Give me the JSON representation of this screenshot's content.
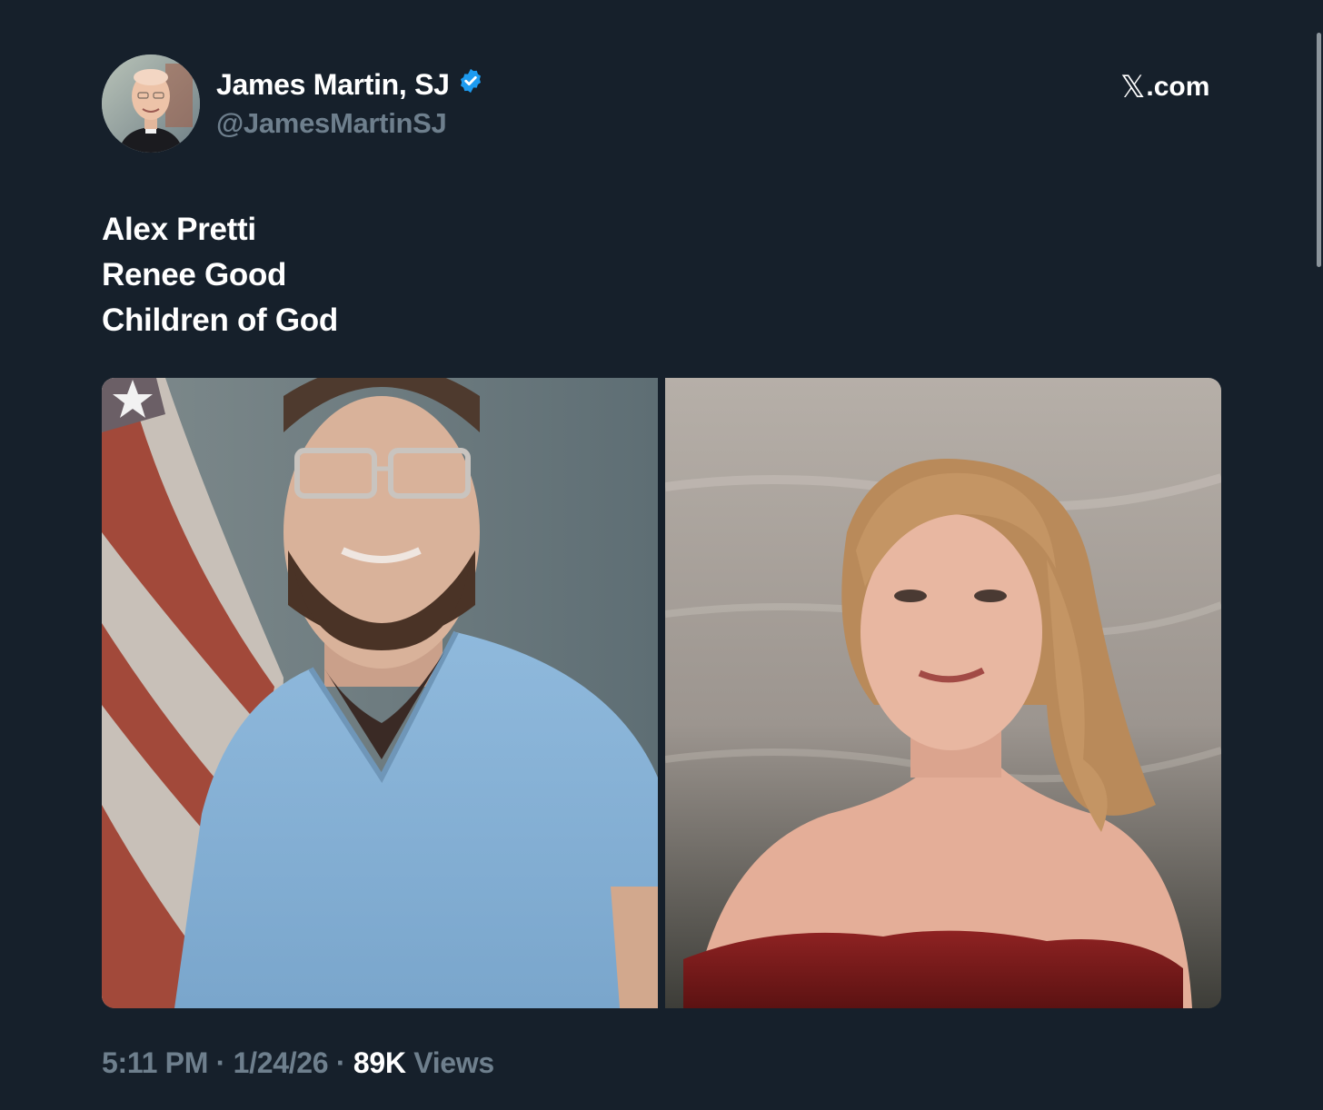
{
  "author": {
    "display_name": "James Martin, SJ",
    "handle": "@JamesMartinSJ",
    "verified_icon": "verified-badge-icon",
    "avatar_icon": "profile-photo"
  },
  "brand": {
    "mark": "𝕏",
    "text": ".com"
  },
  "tweet": {
    "lines": [
      "Alex Pretti",
      "Renee Good",
      "Children of God"
    ]
  },
  "media": [
    {
      "subject": "man-in-blue-scrubs-photo"
    },
    {
      "subject": "woman-in-red-dress-photo"
    }
  ],
  "meta": {
    "time": "5:11 PM",
    "sep1": " · ",
    "date": "1/24/26",
    "sep2": " · ",
    "views_count": "89K",
    "views_label": " Views"
  },
  "colors": {
    "background": "#16202b",
    "primary_text": "#ffffff",
    "secondary_text": "#6e7f8d",
    "verified_blue": "#1d9bf0"
  }
}
